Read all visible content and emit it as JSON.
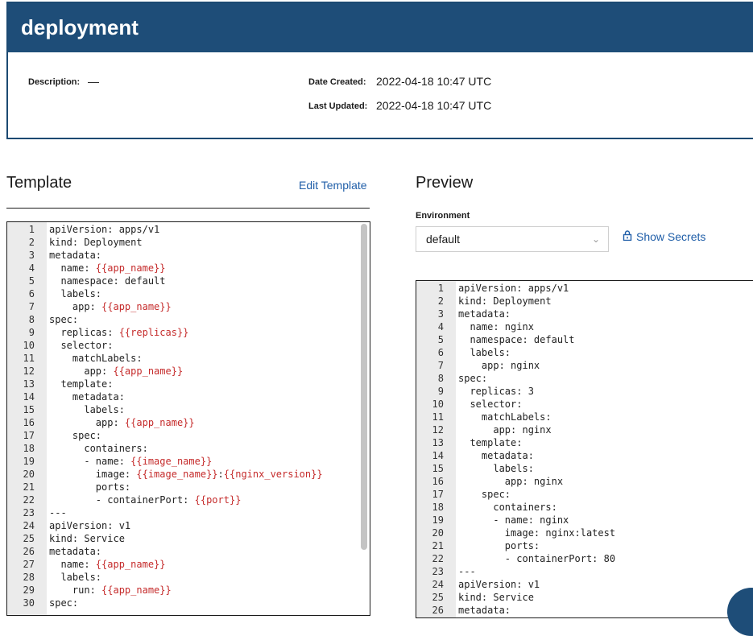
{
  "header": {
    "title": "deployment"
  },
  "meta": {
    "description_label": "Description:",
    "description_value": "—",
    "date_created_label": "Date Created:",
    "date_created_value": "2022-04-18 10:47 UTC",
    "last_updated_label": "Last Updated:",
    "last_updated_value": "2022-04-18 10:47 UTC"
  },
  "template": {
    "title": "Template",
    "edit_label": "Edit Template",
    "lines": [
      "apiVersion: apps/v1",
      "kind: Deployment",
      "metadata:",
      "  name: {{app_name}}",
      "  namespace: default",
      "  labels:",
      "    app: {{app_name}}",
      "spec:",
      "  replicas: {{replicas}}",
      "  selector:",
      "    matchLabels:",
      "      app: {{app_name}}",
      "  template:",
      "    metadata:",
      "      labels:",
      "        app: {{app_name}}",
      "    spec:",
      "      containers:",
      "      - name: {{image_name}}",
      "        image: {{image_name}}:{{nginx_version}}",
      "        ports:",
      "        - containerPort: {{port}}",
      "---",
      "apiVersion: v1",
      "kind: Service",
      "metadata:",
      "  name: {{app_name}}",
      "  labels:",
      "    run: {{app_name}}",
      "spec:"
    ]
  },
  "preview": {
    "title": "Preview",
    "environment_label": "Environment",
    "environment_value": "default",
    "show_secrets_label": "Show Secrets",
    "lines": [
      "apiVersion: apps/v1",
      "kind: Deployment",
      "metadata:",
      "  name: nginx",
      "  namespace: default",
      "  labels:",
      "    app: nginx",
      "spec:",
      "  replicas: 3",
      "  selector:",
      "    matchLabels:",
      "      app: nginx",
      "  template:",
      "    metadata:",
      "      labels:",
      "        app: nginx",
      "    spec:",
      "      containers:",
      "      - name: nginx",
      "        image: nginx:latest",
      "        ports:",
      "        - containerPort: 80",
      "---",
      "apiVersion: v1",
      "kind: Service",
      "metadata:"
    ]
  },
  "icons": {
    "lock": "lock-icon",
    "caret": "chevron-down-icon"
  },
  "colors": {
    "header": "#1e4d78",
    "link": "#1f5ea8",
    "template_var": "#c52b2b"
  }
}
